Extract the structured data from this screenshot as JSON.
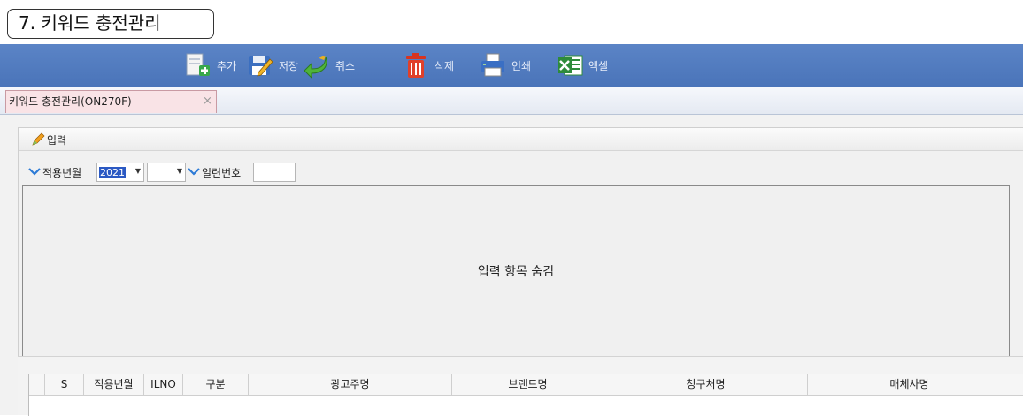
{
  "page_title": "7. 키워드 충전관리",
  "toolbar": {
    "add": "추가",
    "save": "저장",
    "cancel": "취소",
    "delete": "삭제",
    "print": "인쇄",
    "excel": "엑셀"
  },
  "tab": {
    "label": "키워드 충전관리(ON270F)",
    "close": "×"
  },
  "panel": {
    "title": "입력",
    "year_label": "적용년월",
    "year_value": "2021",
    "serial_label": "일련번호",
    "hidden_message": "입력 항목 숨김"
  },
  "grid": {
    "columns": [
      "S",
      "적용년월",
      "ILNO",
      "구분",
      "광고주명",
      "브랜드명",
      "청구처명",
      "매체사명"
    ]
  },
  "icons": {
    "add": "document-add-icon",
    "save": "save-edit-icon",
    "cancel": "undo-arrow-icon",
    "delete": "trash-icon",
    "print": "printer-icon",
    "excel": "excel-icon",
    "pen": "pencil-icon",
    "chevron": "chevron-down-icon"
  },
  "colors": {
    "toolbar": "#4a74b9",
    "tab_active": "#f9e3e6",
    "accent_chevron": "#2d7bd6",
    "delete_red": "#d9341f",
    "excel_green": "#2e8b3a"
  }
}
